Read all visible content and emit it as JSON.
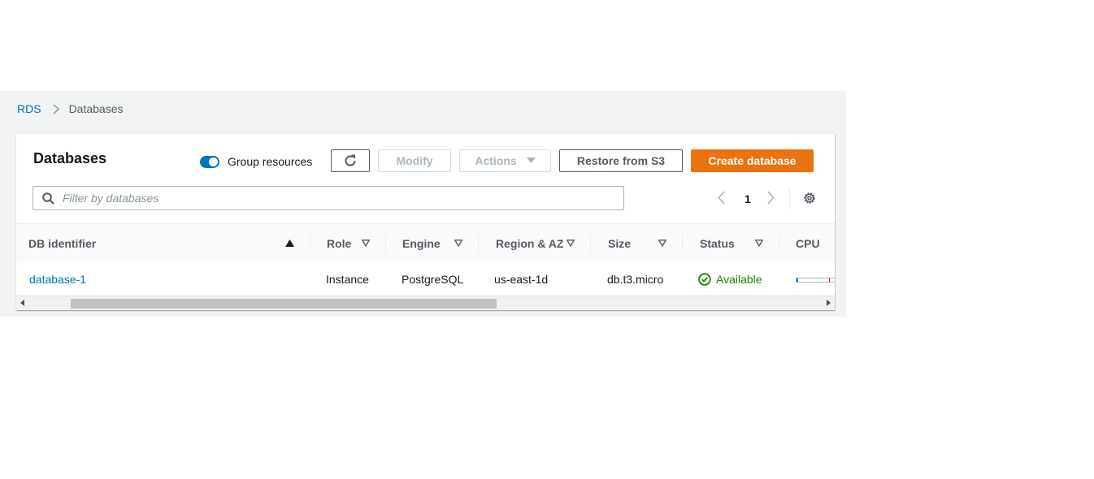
{
  "breadcrumb": {
    "root": "RDS",
    "current": "Databases"
  },
  "panel": {
    "title": "Databases",
    "group_resources": {
      "label": "Group resources",
      "enabled": true
    }
  },
  "toolbar": {
    "modify_label": "Modify",
    "actions_label": "Actions",
    "restore_label": "Restore from S3",
    "create_label": "Create database"
  },
  "search": {
    "placeholder": "Filter by databases",
    "value": ""
  },
  "pagination": {
    "current_page": "1"
  },
  "table": {
    "columns": {
      "db_identifier": "DB identifier",
      "role": "Role",
      "engine": "Engine",
      "region": "Region & AZ",
      "size": "Size",
      "status": "Status",
      "cpu": "CPU"
    },
    "sorted_by": "DB identifier",
    "sort_direction": "ascending",
    "rows": [
      {
        "db_identifier": "database-1",
        "role": "Instance",
        "engine": "PostgreSQL",
        "region": "us-east-1d",
        "size": "db.t3.micro",
        "status": "Available",
        "cpu_fraction": 0.05
      }
    ]
  },
  "scrollbar": {
    "thumb_start_fraction": 0.0,
    "thumb_visible_fraction": 0.57
  },
  "colors": {
    "link": "#0073bb",
    "primary_button": "#ec7211",
    "status_available": "#1d8102",
    "toggle_on": "#0073bb",
    "page_background": "#f2f3f3"
  },
  "icons": {
    "breadcrumb_separator": "chevron-right-icon",
    "refresh": "refresh-icon",
    "actions_caret": "caret-down-icon",
    "search": "search-icon",
    "prev_page": "chevron-left-icon",
    "next_page": "chevron-right-icon",
    "settings": "gear-icon",
    "sort_asc": "sort-ascending-icon",
    "sort": "sort-caret-icon",
    "status": "check-circle-icon"
  }
}
